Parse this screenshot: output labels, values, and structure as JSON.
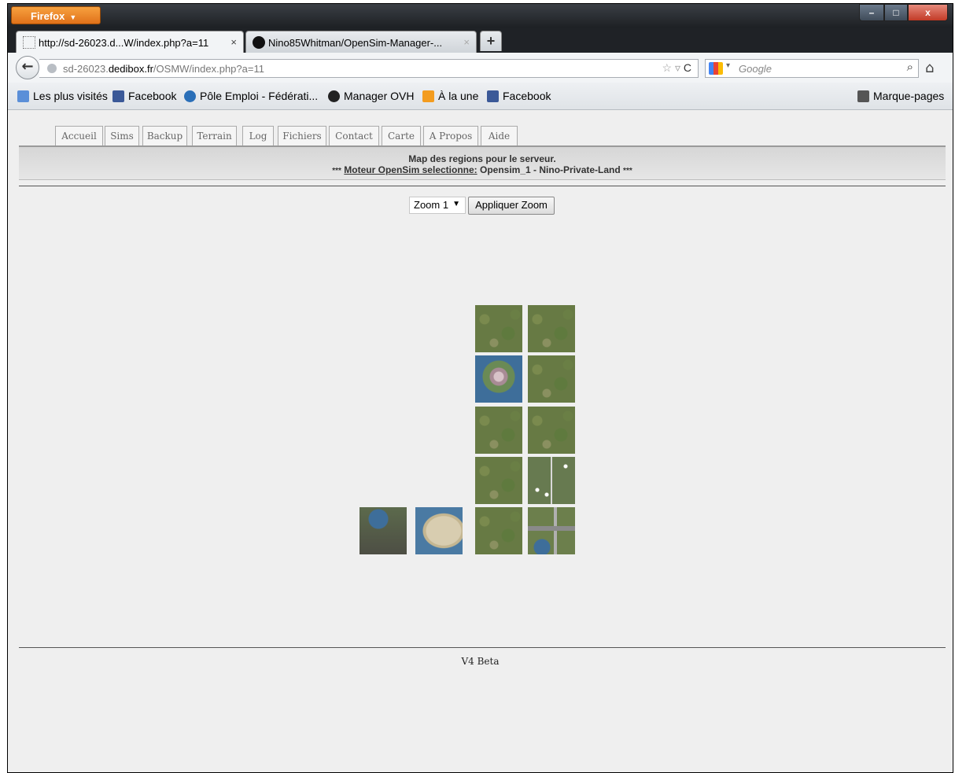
{
  "browser": {
    "menu_button": "Firefox",
    "window_controls": {
      "minimize": "–",
      "maximize": "□",
      "close": "x"
    },
    "tabs": [
      {
        "title": "http://sd-26023.d...W/index.php?a=11",
        "close": "×"
      },
      {
        "title": "Nino85Whitman/OpenSim-Manager-...",
        "close": "×"
      }
    ],
    "new_tab": "+",
    "back": "←",
    "url": {
      "prefix": "sd-26023.",
      "host": "dedibox.fr",
      "path": "/OSMW/index.php?a=11"
    },
    "url_icons": {
      "star": "☆",
      "dropdown": "▿",
      "reload": "C"
    },
    "search": {
      "placeholder": "Google",
      "dropdown": "▾",
      "icon": "⌕"
    },
    "home": "⌂",
    "bookmarks": [
      {
        "label": "Les plus visités",
        "icon": "recent-icon"
      },
      {
        "label": "Facebook",
        "icon": "facebook-icon"
      },
      {
        "label": "Pôle Emploi - Fédérati...",
        "icon": "pole-emploi-icon"
      },
      {
        "label": "Manager OVH",
        "icon": "ovh-icon"
      },
      {
        "label": "À la une",
        "icon": "rss-icon"
      },
      {
        "label": "Facebook",
        "icon": "facebook-icon"
      }
    ],
    "bookmarks_menu": "Marque-pages"
  },
  "page": {
    "menu_tabs": [
      "Accueil",
      "Sims",
      "Backup",
      "Terrain",
      "Log",
      "Fichiers",
      "Contact",
      "Carte",
      "A Propos",
      "Aide"
    ],
    "header": {
      "line1": "Map des regions pour le serveur.",
      "stars_left": "***",
      "engine_label": "Moteur OpenSim selectionne:",
      "engine_value": "Opensim_1 - Nino-Private-Land",
      "stars_right": "***"
    },
    "zoom": {
      "selected": "Zoom 1",
      "dropdown": "▼",
      "apply_button": "Appliquer Zoom"
    },
    "footer": "V4 Beta"
  }
}
